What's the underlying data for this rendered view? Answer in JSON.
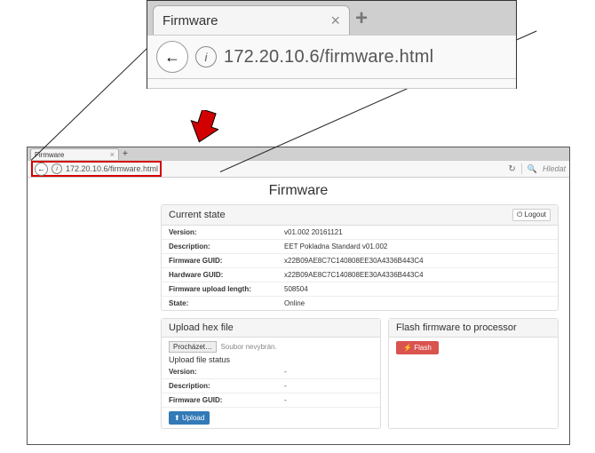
{
  "zoom": {
    "tab_title": "Firmware",
    "url": "172.20.10.6/firmware.html"
  },
  "mini": {
    "tab_title": "Firmware",
    "url": "172.20.10.6/firmware.html",
    "search_placeholder": "Hledat"
  },
  "page": {
    "title": "Firmware",
    "logout_label": "Logout",
    "panels": {
      "current_state": {
        "title": "Current state",
        "rows": {
          "version": {
            "label": "Version:",
            "value": "v01.002 20161121"
          },
          "description": {
            "label": "Description:",
            "value": "EET Pokladna Standard v01.002"
          },
          "fw_guid": {
            "label": "Firmware GUID:",
            "value": "x22B09AE8C7C140808EE30A4336B443C4"
          },
          "hw_guid": {
            "label": "Hardware GUID:",
            "value": "x22B09AE8C7C140808EE30A4336B443C4"
          },
          "upload_len": {
            "label": "Firmware upload length:",
            "value": "508504"
          },
          "state": {
            "label": "State:",
            "value": "Online"
          }
        }
      },
      "upload": {
        "title": "Upload hex file",
        "browse": "Procházet…",
        "no_file": "Soubor nevybrán.",
        "status_title": "Upload file status",
        "rows": {
          "version": {
            "label": "Version:",
            "value": "-"
          },
          "description": {
            "label": "Description:",
            "value": "-"
          },
          "fw_guid": {
            "label": "Firmware GUID:",
            "value": "-"
          }
        },
        "upload_btn": "Upload"
      },
      "flash": {
        "title": "Flash firmware to processor",
        "flash_btn": "Flash"
      }
    }
  }
}
